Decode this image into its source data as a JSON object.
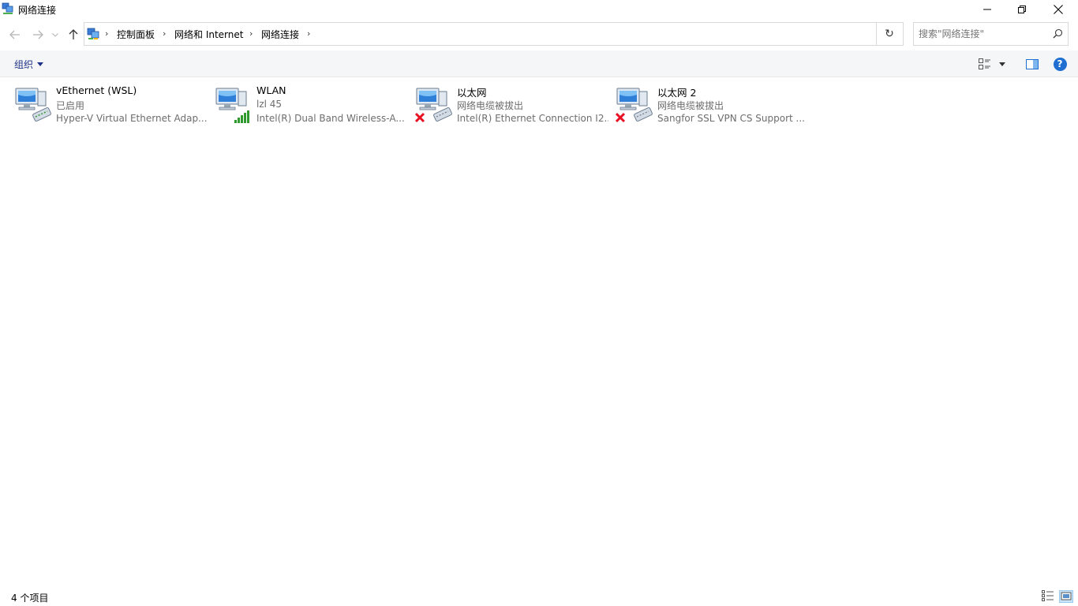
{
  "window": {
    "title": "网络连接",
    "app_icon": "network-connections-icon"
  },
  "caption_buttons": {
    "minimize_icon": "minimize-icon",
    "restore_icon": "restore-icon",
    "close_icon": "close-icon"
  },
  "navigation": {
    "back_icon": "arrow-left-icon",
    "forward_icon": "arrow-right-icon",
    "recent_icon": "chevron-down-icon",
    "up_icon": "arrow-up-icon"
  },
  "breadcrumb": {
    "items": [
      "控制面板",
      "网络和 Internet",
      "网络连接"
    ],
    "separator": "›"
  },
  "refresh_symbol": "↻",
  "search": {
    "placeholder": "搜索\"网络连接\""
  },
  "commandbar": {
    "organize_label": "组织",
    "help_label": "?"
  },
  "connections": [
    {
      "name": "vEthernet (WSL)",
      "status": "已启用",
      "device": "Hyper-V Virtual Ethernet Adap...",
      "overlay": "none"
    },
    {
      "name": "WLAN",
      "status": "lzl 45",
      "device": "Intel(R) Dual Band Wireless-A...",
      "overlay": "signal-bars"
    },
    {
      "name": "以太网",
      "status": "网络电缆被拔出",
      "device": "Intel(R) Ethernet Connection I2...",
      "overlay": "red-x"
    },
    {
      "name": "以太网 2",
      "status": "网络电缆被拔出",
      "device": "Sangfor SSL VPN CS Support ...",
      "overlay": "red-x"
    }
  ],
  "statusbar": {
    "item_count": "4 个项目"
  },
  "colors": {
    "accent_link": "#1e3287",
    "help_blue": "#1e6fd1",
    "secondary_text": "#6d6d6d",
    "error_red": "#e81123",
    "signal_green": "#2e9a2e"
  }
}
